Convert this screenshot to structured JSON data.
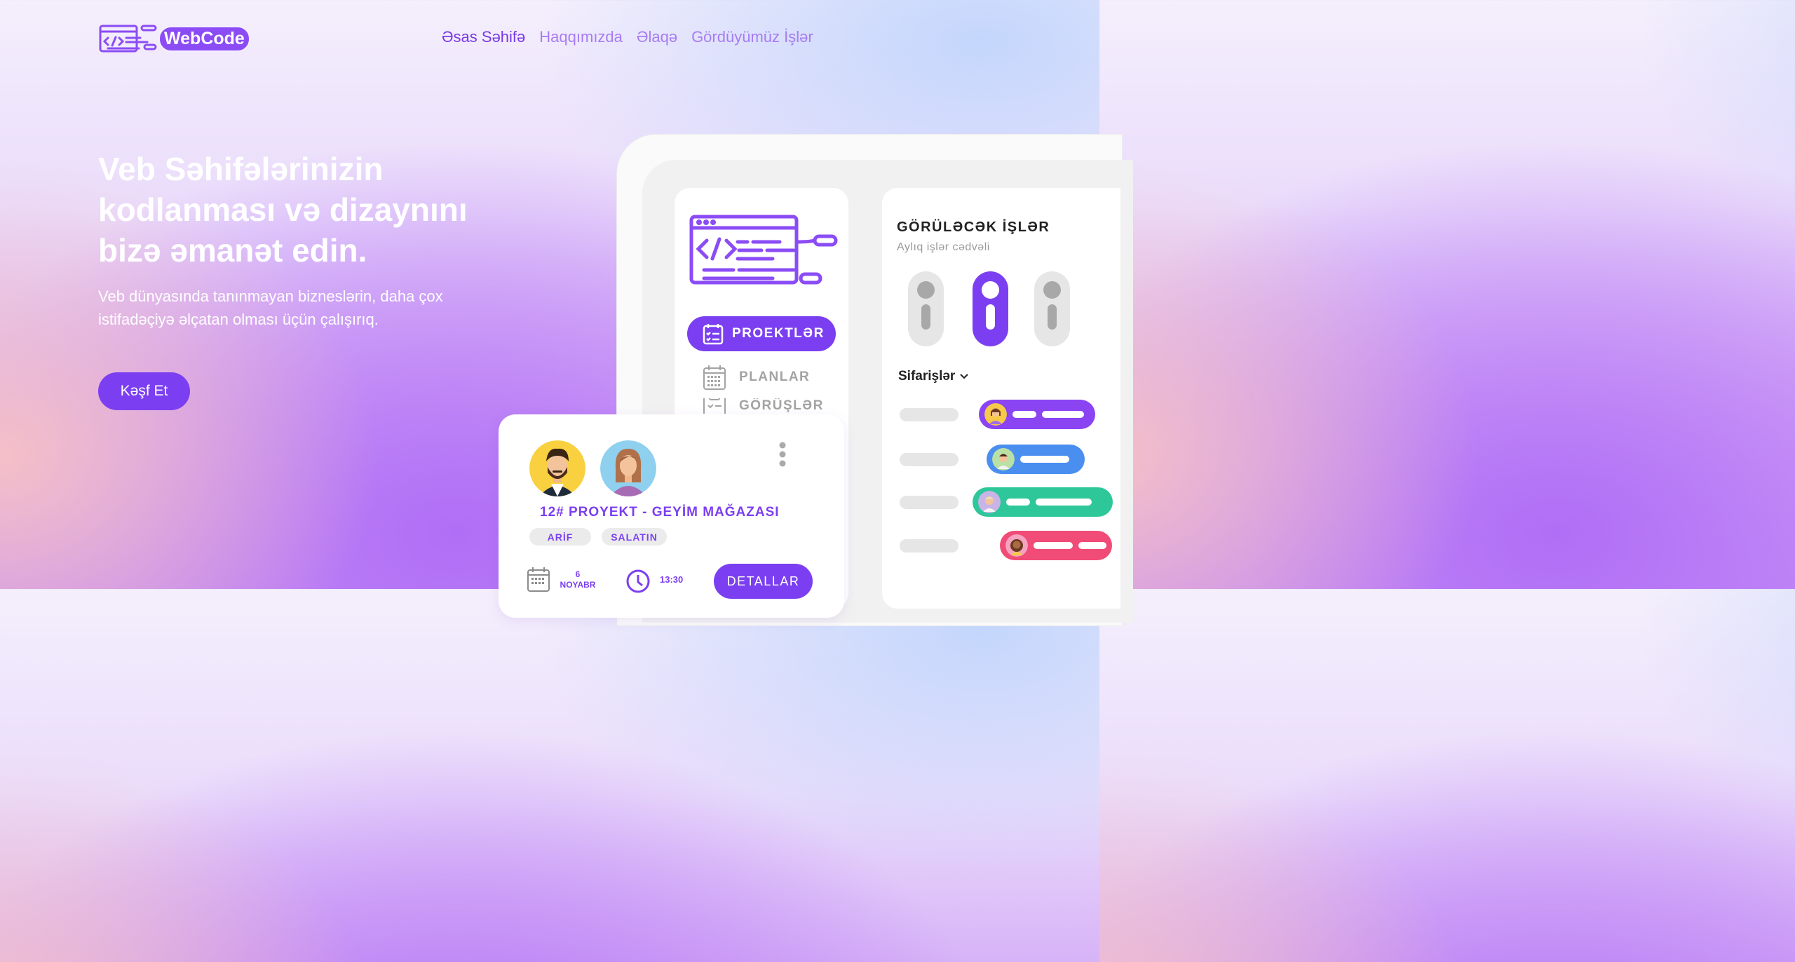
{
  "brand": {
    "name": "WebCode"
  },
  "nav": {
    "items": [
      {
        "label": "Əsas Səhifə",
        "active": true
      },
      {
        "label": "Haqqımızda",
        "active": false
      },
      {
        "label": "Əlaqə",
        "active": false
      },
      {
        "label": "Gördüyümüz İşlər",
        "active": false
      }
    ]
  },
  "hero": {
    "title": "Veb Səhifələrinizin kodlanması və dizaynını bizə əmanət edin.",
    "subtitle": "Veb dünyasında tanınmayan bizneslərin, daha çox istifadəçiyə əlçatan olması üçün çalışırıq.",
    "cta_label": "Kəşf Et"
  },
  "dashboard": {
    "menu": {
      "projects": "PROEKTLƏR",
      "plans": "PLANLAR",
      "meetings": "GÖRÜŞLƏR"
    },
    "todo_title": "GÖRÜLƏCƏK İŞLƏR",
    "todo_subtitle": "Aylıq işlər cədvəli",
    "orders_label": "Sifarişlər",
    "order_colors": [
      "#8b44f2",
      "#4a8ef0",
      "#2ec79a",
      "#f04c77"
    ]
  },
  "project_card": {
    "title": "12# PROYEKT - GEYİM MAĞAZASI",
    "tags": [
      "ARİF",
      "SALATIN"
    ],
    "date_day": "6",
    "date_month": "NOYABR",
    "time": "13:30",
    "details_label": "DETALLAR"
  },
  "colors": {
    "accent": "#7b3ff1",
    "nav_text": "#a77cf2",
    "nav_active": "#7a3ae6"
  }
}
